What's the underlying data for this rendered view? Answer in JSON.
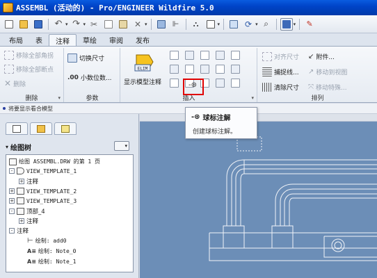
{
  "window": {
    "title": "ASSEMBL (活动的) - Pro/ENGINEER Wildfire 5.0"
  },
  "ribbon_tabs": [
    "布局",
    "表",
    "注释",
    "草绘",
    "审阅",
    "发布"
  ],
  "active_tab": "注释",
  "groups": {
    "delete": {
      "label": "删除",
      "items": [
        "移除全部角拐",
        "移除全部断点",
        "删除"
      ]
    },
    "params": {
      "label": "参数",
      "items": [
        "切换尺寸",
        "小数位数..."
      ]
    },
    "insert": {
      "label": "插入",
      "show_model_annotations": "显示模型注释"
    },
    "arrange": {
      "label": "排列",
      "items": [
        "对齐尺寸",
        "附件...",
        "捕捉线...",
        "移动到视图",
        "清除尺寸",
        "移动特殊..."
      ]
    }
  },
  "status_hint": "将要显示看合模型",
  "model_tree": {
    "title": "绘图树",
    "items": [
      {
        "text": "绘图 ASSEMBL.DRW 的第 1 页",
        "level": 0
      },
      {
        "text": "VIEW_TEMPLATE_1",
        "level": 1
      },
      {
        "text": "注释",
        "level": 2
      },
      {
        "text": "VIEW_TEMPLATE_2",
        "level": 1
      },
      {
        "text": "VIEW_TEMPLATE_3",
        "level": 1
      },
      {
        "text": "顶部_4",
        "level": 1
      },
      {
        "text": "注释",
        "level": 2
      },
      {
        "text": "注释",
        "level": 0
      },
      {
        "text": "绘制: add0",
        "level": 2
      },
      {
        "text": "绘制: Note_0",
        "level": 2
      },
      {
        "text": "绘制: Note_1",
        "level": 2
      }
    ]
  },
  "tooltip": {
    "title": "球标注解",
    "description": "创建球标注解。"
  },
  "colors": {
    "titlebar": "#0050d8",
    "canvas": "#6c8eb7",
    "highlight": "#e00000"
  }
}
